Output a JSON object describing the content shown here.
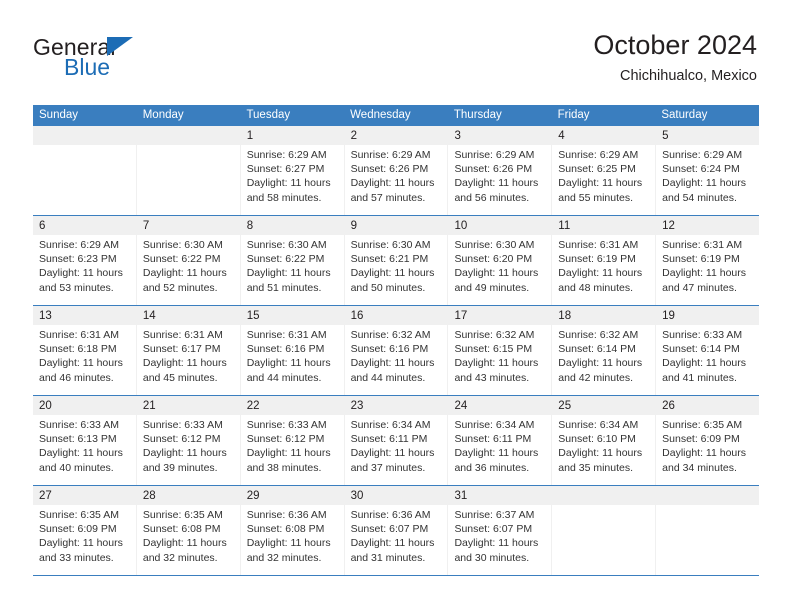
{
  "brand": {
    "name_part1": "General",
    "name_part2": "Blue",
    "triangle_color": "#1c6cb5"
  },
  "header": {
    "title": "October 2024",
    "subtitle": "Chichihualco, Mexico"
  },
  "colors": {
    "header_blue": "#3a7ebf",
    "day_strip_gray": "#f0f0f0",
    "text": "#231f20"
  },
  "calendar": {
    "weekdays": [
      "Sunday",
      "Monday",
      "Tuesday",
      "Wednesday",
      "Thursday",
      "Friday",
      "Saturday"
    ],
    "weeks": [
      [
        {
          "day": "",
          "empty": true,
          "sunrise": "",
          "sunset": "",
          "daylight_1": "",
          "daylight_2": ""
        },
        {
          "day": "",
          "empty": true,
          "sunrise": "",
          "sunset": "",
          "daylight_1": "",
          "daylight_2": ""
        },
        {
          "day": "1",
          "sunrise": "Sunrise: 6:29 AM",
          "sunset": "Sunset: 6:27 PM",
          "daylight_1": "Daylight: 11 hours",
          "daylight_2": "and 58 minutes."
        },
        {
          "day": "2",
          "sunrise": "Sunrise: 6:29 AM",
          "sunset": "Sunset: 6:26 PM",
          "daylight_1": "Daylight: 11 hours",
          "daylight_2": "and 57 minutes."
        },
        {
          "day": "3",
          "sunrise": "Sunrise: 6:29 AM",
          "sunset": "Sunset: 6:26 PM",
          "daylight_1": "Daylight: 11 hours",
          "daylight_2": "and 56 minutes."
        },
        {
          "day": "4",
          "sunrise": "Sunrise: 6:29 AM",
          "sunset": "Sunset: 6:25 PM",
          "daylight_1": "Daylight: 11 hours",
          "daylight_2": "and 55 minutes."
        },
        {
          "day": "5",
          "sunrise": "Sunrise: 6:29 AM",
          "sunset": "Sunset: 6:24 PM",
          "daylight_1": "Daylight: 11 hours",
          "daylight_2": "and 54 minutes."
        }
      ],
      [
        {
          "day": "6",
          "sunrise": "Sunrise: 6:29 AM",
          "sunset": "Sunset: 6:23 PM",
          "daylight_1": "Daylight: 11 hours",
          "daylight_2": "and 53 minutes."
        },
        {
          "day": "7",
          "sunrise": "Sunrise: 6:30 AM",
          "sunset": "Sunset: 6:22 PM",
          "daylight_1": "Daylight: 11 hours",
          "daylight_2": "and 52 minutes."
        },
        {
          "day": "8",
          "sunrise": "Sunrise: 6:30 AM",
          "sunset": "Sunset: 6:22 PM",
          "daylight_1": "Daylight: 11 hours",
          "daylight_2": "and 51 minutes."
        },
        {
          "day": "9",
          "sunrise": "Sunrise: 6:30 AM",
          "sunset": "Sunset: 6:21 PM",
          "daylight_1": "Daylight: 11 hours",
          "daylight_2": "and 50 minutes."
        },
        {
          "day": "10",
          "sunrise": "Sunrise: 6:30 AM",
          "sunset": "Sunset: 6:20 PM",
          "daylight_1": "Daylight: 11 hours",
          "daylight_2": "and 49 minutes."
        },
        {
          "day": "11",
          "sunrise": "Sunrise: 6:31 AM",
          "sunset": "Sunset: 6:19 PM",
          "daylight_1": "Daylight: 11 hours",
          "daylight_2": "and 48 minutes."
        },
        {
          "day": "12",
          "sunrise": "Sunrise: 6:31 AM",
          "sunset": "Sunset: 6:19 PM",
          "daylight_1": "Daylight: 11 hours",
          "daylight_2": "and 47 minutes."
        }
      ],
      [
        {
          "day": "13",
          "sunrise": "Sunrise: 6:31 AM",
          "sunset": "Sunset: 6:18 PM",
          "daylight_1": "Daylight: 11 hours",
          "daylight_2": "and 46 minutes."
        },
        {
          "day": "14",
          "sunrise": "Sunrise: 6:31 AM",
          "sunset": "Sunset: 6:17 PM",
          "daylight_1": "Daylight: 11 hours",
          "daylight_2": "and 45 minutes."
        },
        {
          "day": "15",
          "sunrise": "Sunrise: 6:31 AM",
          "sunset": "Sunset: 6:16 PM",
          "daylight_1": "Daylight: 11 hours",
          "daylight_2": "and 44 minutes."
        },
        {
          "day": "16",
          "sunrise": "Sunrise: 6:32 AM",
          "sunset": "Sunset: 6:16 PM",
          "daylight_1": "Daylight: 11 hours",
          "daylight_2": "and 44 minutes."
        },
        {
          "day": "17",
          "sunrise": "Sunrise: 6:32 AM",
          "sunset": "Sunset: 6:15 PM",
          "daylight_1": "Daylight: 11 hours",
          "daylight_2": "and 43 minutes."
        },
        {
          "day": "18",
          "sunrise": "Sunrise: 6:32 AM",
          "sunset": "Sunset: 6:14 PM",
          "daylight_1": "Daylight: 11 hours",
          "daylight_2": "and 42 minutes."
        },
        {
          "day": "19",
          "sunrise": "Sunrise: 6:33 AM",
          "sunset": "Sunset: 6:14 PM",
          "daylight_1": "Daylight: 11 hours",
          "daylight_2": "and 41 minutes."
        }
      ],
      [
        {
          "day": "20",
          "sunrise": "Sunrise: 6:33 AM",
          "sunset": "Sunset: 6:13 PM",
          "daylight_1": "Daylight: 11 hours",
          "daylight_2": "and 40 minutes."
        },
        {
          "day": "21",
          "sunrise": "Sunrise: 6:33 AM",
          "sunset": "Sunset: 6:12 PM",
          "daylight_1": "Daylight: 11 hours",
          "daylight_2": "and 39 minutes."
        },
        {
          "day": "22",
          "sunrise": "Sunrise: 6:33 AM",
          "sunset": "Sunset: 6:12 PM",
          "daylight_1": "Daylight: 11 hours",
          "daylight_2": "and 38 minutes."
        },
        {
          "day": "23",
          "sunrise": "Sunrise: 6:34 AM",
          "sunset": "Sunset: 6:11 PM",
          "daylight_1": "Daylight: 11 hours",
          "daylight_2": "and 37 minutes."
        },
        {
          "day": "24",
          "sunrise": "Sunrise: 6:34 AM",
          "sunset": "Sunset: 6:11 PM",
          "daylight_1": "Daylight: 11 hours",
          "daylight_2": "and 36 minutes."
        },
        {
          "day": "25",
          "sunrise": "Sunrise: 6:34 AM",
          "sunset": "Sunset: 6:10 PM",
          "daylight_1": "Daylight: 11 hours",
          "daylight_2": "and 35 minutes."
        },
        {
          "day": "26",
          "sunrise": "Sunrise: 6:35 AM",
          "sunset": "Sunset: 6:09 PM",
          "daylight_1": "Daylight: 11 hours",
          "daylight_2": "and 34 minutes."
        }
      ],
      [
        {
          "day": "27",
          "sunrise": "Sunrise: 6:35 AM",
          "sunset": "Sunset: 6:09 PM",
          "daylight_1": "Daylight: 11 hours",
          "daylight_2": "and 33 minutes."
        },
        {
          "day": "28",
          "sunrise": "Sunrise: 6:35 AM",
          "sunset": "Sunset: 6:08 PM",
          "daylight_1": "Daylight: 11 hours",
          "daylight_2": "and 32 minutes."
        },
        {
          "day": "29",
          "sunrise": "Sunrise: 6:36 AM",
          "sunset": "Sunset: 6:08 PM",
          "daylight_1": "Daylight: 11 hours",
          "daylight_2": "and 32 minutes."
        },
        {
          "day": "30",
          "sunrise": "Sunrise: 6:36 AM",
          "sunset": "Sunset: 6:07 PM",
          "daylight_1": "Daylight: 11 hours",
          "daylight_2": "and 31 minutes."
        },
        {
          "day": "31",
          "sunrise": "Sunrise: 6:37 AM",
          "sunset": "Sunset: 6:07 PM",
          "daylight_1": "Daylight: 11 hours",
          "daylight_2": "and 30 minutes."
        },
        {
          "day": "",
          "empty": true,
          "sunrise": "",
          "sunset": "",
          "daylight_1": "",
          "daylight_2": ""
        },
        {
          "day": "",
          "empty": true,
          "sunrise": "",
          "sunset": "",
          "daylight_1": "",
          "daylight_2": ""
        }
      ]
    ]
  }
}
